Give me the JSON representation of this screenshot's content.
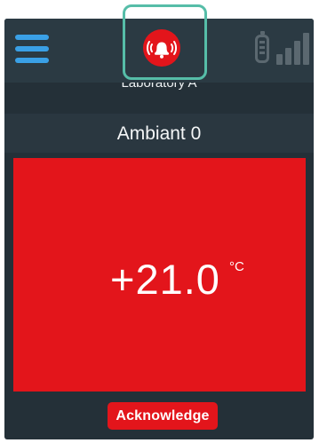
{
  "topbar": {
    "menu_icon": "hamburger-menu-icon",
    "alarm_icon": "alarm-bell-icon",
    "battery_icon": "battery-icon",
    "signal_icon": "signal-strength-icon",
    "location": "Laboratory A"
  },
  "sensor": {
    "name": "Ambiant 0",
    "value": "+21.0",
    "unit": "°C",
    "alarm_color": "#e3151b"
  },
  "actions": {
    "acknowledge_label": "Acknowledge"
  },
  "colors": {
    "screen_background": "#243038",
    "menu_accent": "#3aa0e6",
    "highlight_outline": "#56bda8"
  }
}
